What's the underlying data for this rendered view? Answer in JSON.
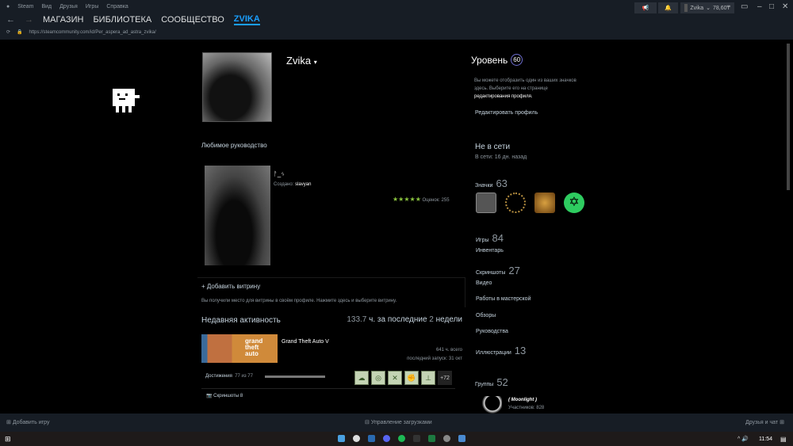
{
  "menu": [
    "Steam",
    "Вид",
    "Друзья",
    "Игры",
    "Справка"
  ],
  "nav": [
    "МАГАЗИН",
    "БИБЛИОТЕКА",
    "СООБЩЕСТВО",
    "ZVIKA"
  ],
  "url": "https://steamcommunity.com/id/Per_aspera_ad_astra_zvika/",
  "account": {
    "name": "Zvika",
    "balance": "78,60₸"
  },
  "profile": {
    "name": "Zvika",
    "level_label": "Уровень",
    "level": "60",
    "badge_hint": "Вы можете отобразить один из ваших значков здесь. Выберите его на странице",
    "badge_hint_link": "редактирования профиля.",
    "edit": "Редактировать профиль",
    "status": "Не в сети",
    "last_online": "В сети: 16 дн. назад",
    "badges_label": "Значки",
    "badges_count": "63"
  },
  "guide": {
    "section": "Любимое руководство",
    "title": "ᚨ_ᛃ",
    "by_label": "Создано:",
    "author": "slavyan",
    "stars": "★★★★★",
    "rating": "Оценок: 255"
  },
  "showcase": {
    "add": "+ Добавить витрину",
    "hint": "Вы получили место для витрины в своём профиле. Нажмите здесь и выберите витрину."
  },
  "activity": {
    "title": "Недавняя активность",
    "hours": "133.7",
    "hours_mid": "ч. за последние",
    "weeks": "2",
    "weeks_label": "недели",
    "game": "Grand Theft Auto V",
    "total": "641 ч. всего",
    "last": "последний запуск: 31 окт",
    "ach_label": "Достижения",
    "ach_value": "77 из 77",
    "ach_progress": 1.0,
    "ach_more": "+72",
    "screens": "Скриншоты 8"
  },
  "stats": [
    {
      "label": "Игры",
      "count": "84"
    },
    {
      "label": "Инвентарь",
      "count": ""
    },
    {
      "label": "Скриншоты",
      "count": "27"
    },
    {
      "label": "Видео",
      "count": ""
    },
    {
      "label": "Работы в мастерской",
      "count": ""
    },
    {
      "label": "Обзоры",
      "count": ""
    },
    {
      "label": "Руководства",
      "count": ""
    },
    {
      "label": "Иллюстрации",
      "count": "13"
    }
  ],
  "groups": {
    "label": "Группы",
    "count": "52",
    "name": "( Moonlight )",
    "members": "Участников: 828"
  },
  "bottom": {
    "add_game": "Добавить игру",
    "downloads": "Управление загрузками",
    "friends": "Друзья и чат"
  },
  "taskbar": {
    "time": "11:54"
  },
  "colors": {
    "accent": "#1a9fff",
    "stars": "#8bc53f"
  }
}
